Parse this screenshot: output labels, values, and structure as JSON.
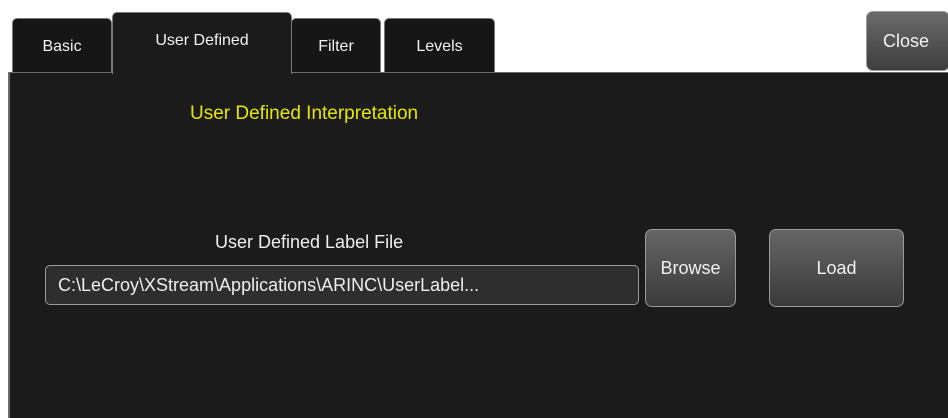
{
  "tabs": [
    {
      "label": "Basic"
    },
    {
      "label": "User Defined"
    },
    {
      "label": "Filter"
    },
    {
      "label": "Levels"
    }
  ],
  "active_tab": "User Defined",
  "close_label": "Close",
  "heading": "User Defined Interpretation",
  "label_file": {
    "label": "User Defined Label File",
    "value": "C:\\LeCroy\\XStream\\Applications\\ARINC\\UserLabel...",
    "browse_label": "Browse",
    "load_label": "Load"
  },
  "colors": {
    "panel_bg": "#1b1b1b",
    "heading": "#e6e600",
    "text": "#f2f2f2",
    "border": "#9a9a9a"
  }
}
